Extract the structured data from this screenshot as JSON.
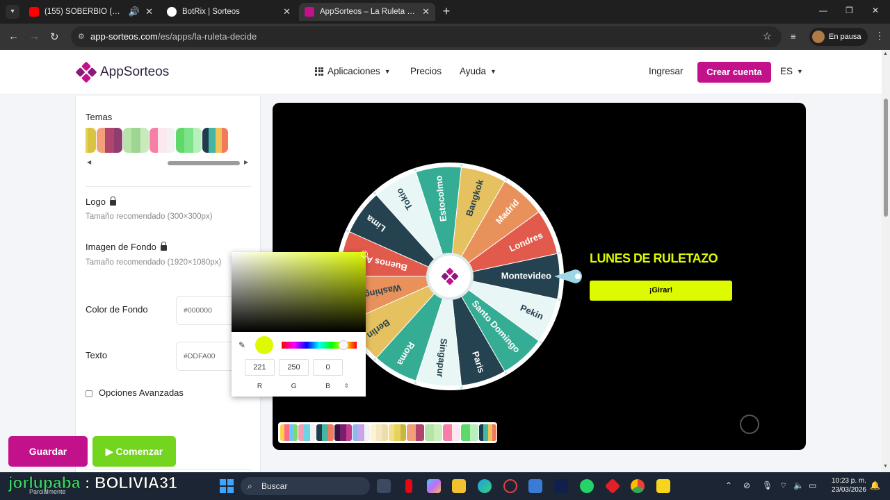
{
  "browser": {
    "tabs": [
      {
        "title": "(155) SOBERBIO (REMIX) - Y",
        "favicon_color": "#ff0000",
        "active": false
      },
      {
        "title": "BotRix | Sorteos",
        "favicon_color": "#ffffff",
        "active": false
      },
      {
        "title": "AppSorteos – La Ruleta de la Su",
        "favicon_color": "#c3118c",
        "active": true
      }
    ],
    "url_site": "app-sorteos.com",
    "url_path": "/es/apps/la-ruleta-decide",
    "profile_label": "En pausa"
  },
  "header": {
    "brand": "AppSorteos",
    "nav": {
      "apps": "Aplicaciones",
      "pricing": "Precios",
      "help": "Ayuda"
    },
    "login": "Ingresar",
    "signup": "Crear cuenta",
    "lang": "ES",
    "brand_color": "#c3118c"
  },
  "panel": {
    "themes_label": "Temas",
    "themes": [
      [
        "#f0e08a",
        "#e8d35a",
        "#d8c440"
      ],
      [
        "#f2a07a",
        "#b0466e",
        "#8e3d6e"
      ],
      [
        "#b6e3a8",
        "#9fd492",
        "#c9ebbc"
      ],
      [
        "#f77ea6",
        "#fbe8ef",
        "#f2f2f2"
      ],
      [
        "#5fd86a",
        "#7de389",
        "#b7f0bc"
      ],
      [
        "#1f3b4d",
        "#44b6a3",
        "#f2c25a",
        "#f27a5a"
      ]
    ],
    "logo_label": "Logo",
    "logo_hint": "Tamaño recomendado (300×300px)",
    "bg_image_label": "Imagen de Fondo",
    "bg_image_hint": "Tamaño recomendado (1920×1080px)",
    "bg_color_label": "Color de Fondo",
    "bg_color_value": "#000000",
    "text_label": "Texto",
    "text_color_value": "#DDFA00",
    "advanced_label": "Opciones Avanzadas",
    "save_label": "Guardar",
    "start_label": "▶ Comenzar"
  },
  "picker": {
    "r": "221",
    "g": "250",
    "b": "0",
    "r_label": "R",
    "g_label": "G",
    "b_label": "B",
    "color": "#ddfa00"
  },
  "wheel": {
    "title": "LUNES DE RULETAZO",
    "spin_label": "¡Girar!",
    "segments": [
      {
        "label": "Montevideo",
        "color": "#24424f",
        "text": "#ffffff"
      },
      {
        "label": "Pekin",
        "color": "#e9f6f6",
        "text": "#24424f"
      },
      {
        "label": "Santo Domingo",
        "color": "#35ad94",
        "text": "#ffffff"
      },
      {
        "label": "Paris",
        "color": "#24424f",
        "text": "#ffffff"
      },
      {
        "label": "Singapur",
        "color": "#e9f6f6",
        "text": "#24424f"
      },
      {
        "label": "Roma",
        "color": "#35ad94",
        "text": "#ffffff"
      },
      {
        "label": "Berlin",
        "color": "#e6c15f",
        "text": "#24424f"
      },
      {
        "label": "Washington",
        "color": "#e8915b",
        "text": "#24424f"
      },
      {
        "label": "Buenos Aires",
        "color": "#e15a4c",
        "text": "#ffffff"
      },
      {
        "label": "Lima",
        "color": "#24424f",
        "text": "#ffffff"
      },
      {
        "label": "Tokio",
        "color": "#e9f6f6",
        "text": "#24424f"
      },
      {
        "label": "Estocolmo",
        "color": "#35ad94",
        "text": "#ffffff"
      },
      {
        "label": "Bangkok",
        "color": "#e6c15f",
        "text": "#24424f"
      },
      {
        "label": "Madrid",
        "color": "#e8915b",
        "text": "#ffffff"
      },
      {
        "label": "Londres",
        "color": "#e15a4c",
        "text": "#ffffff"
      }
    ]
  },
  "palettes": [
    [
      "#ffd24a",
      "#ff6b8b",
      "#6bc5ff",
      "#7bdc6a"
    ],
    [
      "#f49fb4",
      "#6fd3e6",
      "#f2f2f2"
    ],
    [
      "#1f3b4d",
      "#44b6a3",
      "#f27a5a"
    ],
    [
      "#3a1244",
      "#7a1f6e",
      "#c43d8b"
    ],
    [
      "#8fb8f0",
      "#c7a6e8",
      "#f2f2f2"
    ],
    [
      "#fdf3d0",
      "#f4e6c0",
      "#eddca8"
    ],
    [
      "#f0e08a",
      "#e8d35a",
      "#c9b640"
    ],
    [
      "#f2a07a",
      "#b0466e"
    ],
    [
      "#b6e3a8",
      "#cbeebd"
    ],
    [
      "#f77ea6",
      "#fbe8ef"
    ],
    [
      "#5fd86a",
      "#b7f0bc"
    ],
    [
      "#1f3b4d",
      "#44b6a3",
      "#f2c25a",
      "#f27a5a"
    ]
  ],
  "taskbar": {
    "overlay_name_a": "jorlupaba",
    "overlay_name_b": " : BOLIVIA31",
    "overlay_sub": "Parcialmente",
    "search": "Buscar",
    "time": "10:23 p. m.",
    "date": "23/03/2026"
  }
}
